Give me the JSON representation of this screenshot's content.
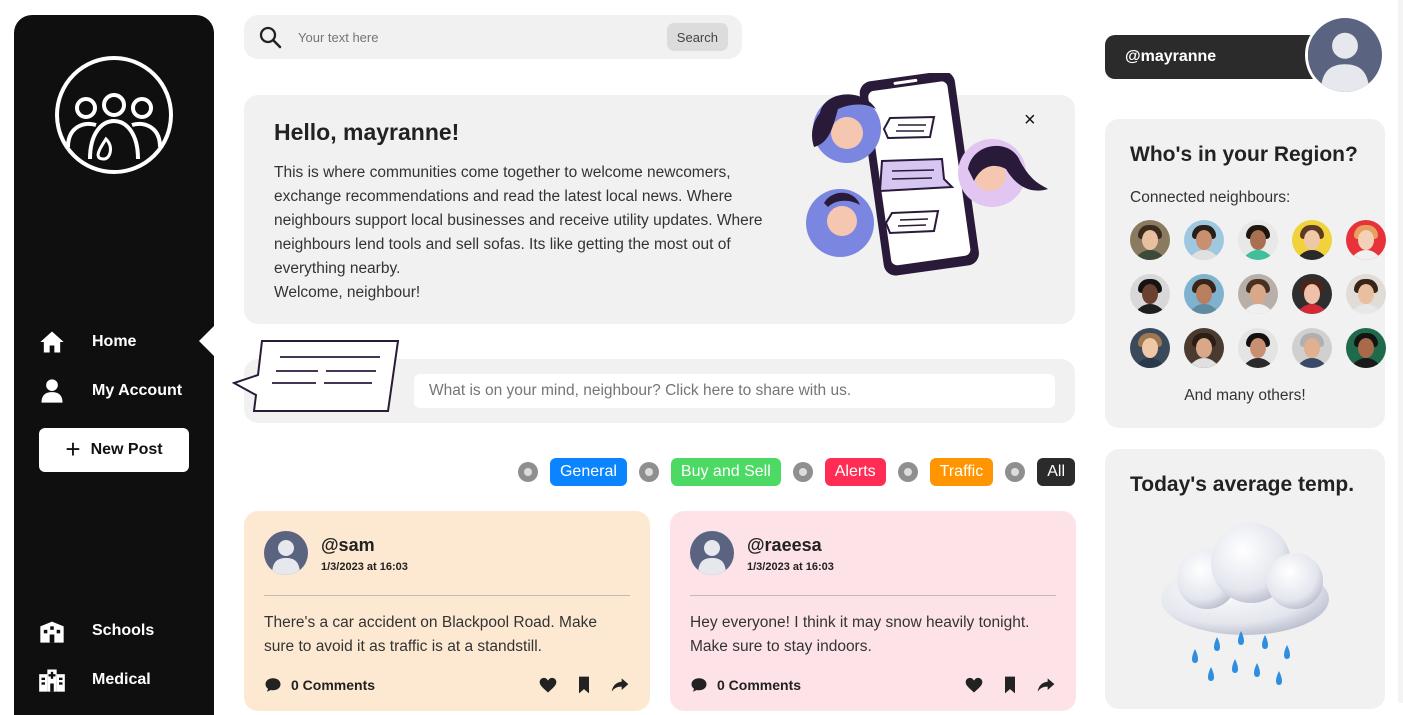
{
  "search": {
    "placeholder": "Your text here",
    "button_label": "Search"
  },
  "sidebar": {
    "items": [
      {
        "label": "Home"
      },
      {
        "label": "My Account"
      },
      {
        "label": "Schools"
      },
      {
        "label": "Medical"
      }
    ],
    "new_post_label": "New Post"
  },
  "hero": {
    "title": "Hello, mayranne!",
    "body": "This is where communities come together to welcome newcomers, exchange recommendations and read the latest local news. Where neighbours support local businesses and receive utility updates. Where neighbours lend tools and sell sofas. Its like getting the most out of everything nearby.",
    "welcome": "Welcome, neighbour!",
    "close_label": "×"
  },
  "composer": {
    "placeholder": "What is on your mind, neighbour? Click here to share with us."
  },
  "filters": [
    {
      "label": "General",
      "color": "#0a84ff"
    },
    {
      "label": "Buy and Sell",
      "color": "#4cd964"
    },
    {
      "label": "Alerts",
      "color": "#ff2d55"
    },
    {
      "label": "Traffic",
      "color": "#ff9500"
    },
    {
      "label": "All",
      "color": "#2b2b2b"
    }
  ],
  "posts": [
    {
      "user": "@sam",
      "time": "1/3/2023 at 16:03",
      "body": "There's a car accident on Blackpool Road. Make sure to avoid it as traffic is at a standstill.",
      "comments": "0 Comments",
      "bg": "#fde9d2"
    },
    {
      "user": "@raeesa",
      "time": "1/3/2023 at 16:03",
      "body": "Hey everyone! I think it may snow heavily tonight. Make sure to stay indoors.",
      "comments": "0 Comments",
      "bg": "#fde3e8"
    }
  ],
  "profile": {
    "handle": "@mayranne"
  },
  "region": {
    "title": "Who's in your Region?",
    "subtitle": "Connected neighbours:",
    "others": "And many others!"
  },
  "temperature": {
    "title": "Today's average temp."
  }
}
